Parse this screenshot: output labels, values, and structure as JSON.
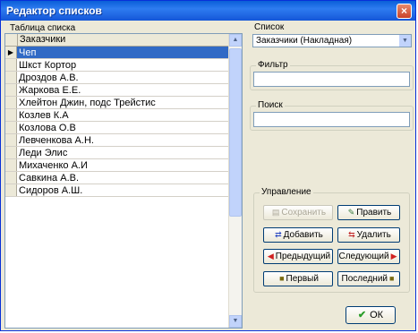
{
  "window": {
    "title": "Редактор списков",
    "close_label": "×"
  },
  "table": {
    "caption": "Таблица списка",
    "column_header": "Заказчики",
    "current_row_marker": "▶",
    "rows": [
      "Чеп",
      "Шкст Кортор",
      "Дроздов А.В.",
      "Жаркова Е.Е.",
      "Хлейтон Джин, подс Трейстис",
      "Козлев К.А",
      "Козлова О.В",
      "Левченкова А.Н.",
      "Леди Элис",
      "Михаченко А.И",
      "Савкина А.В.",
      "Сидоров А.Ш."
    ],
    "selected_index": 0
  },
  "list_selector": {
    "label": "Список",
    "value": "Заказчики (Накладная)"
  },
  "filter": {
    "label": "Фильтр",
    "value": ""
  },
  "search": {
    "label": "Поиск",
    "value": ""
  },
  "controls": {
    "label": "Управление",
    "save": "Сохранить",
    "edit": "Править",
    "add": "Добавить",
    "delete": "Удалить",
    "previous": "Предыдущий",
    "next": "Следующий",
    "first": "Первый",
    "last": "Последний"
  },
  "ok_button": {
    "label": "ОК"
  },
  "icons": {
    "save": "save-icon",
    "edit": "edit-icon",
    "add": "add-icon",
    "delete": "delete-icon",
    "prev": "arrow-left-icon",
    "next": "arrow-right-icon",
    "first": "first-icon",
    "last": "last-icon",
    "ok": "checkmark-icon"
  },
  "colors": {
    "titlebar": "#0a5fd8",
    "selection": "#316ac5",
    "window_bg": "#ece9d8"
  }
}
